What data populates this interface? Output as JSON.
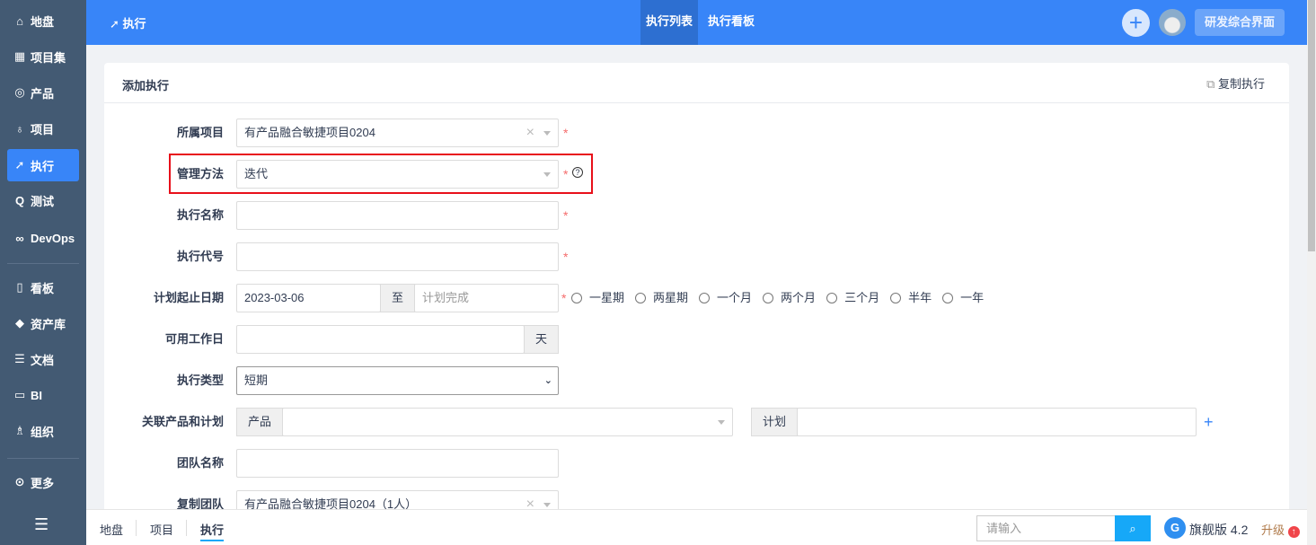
{
  "sidebar": {
    "items": [
      {
        "label": "地盘",
        "icon": "home-icon"
      },
      {
        "label": "项目集",
        "icon": "grid-icon"
      },
      {
        "label": "产品",
        "icon": "bulb-icon"
      },
      {
        "label": "项目",
        "icon": "rocket-icon"
      },
      {
        "label": "执行",
        "icon": "run-icon"
      },
      {
        "label": "测试",
        "icon": "test-icon"
      },
      {
        "label": "DevOps",
        "icon": "infinity-icon"
      },
      {
        "label": "看板",
        "icon": "kanban-icon"
      },
      {
        "label": "资产库",
        "icon": "diamond-icon"
      },
      {
        "label": "文档",
        "icon": "doc-icon"
      },
      {
        "label": "BI",
        "icon": "bi-icon"
      },
      {
        "label": "组织",
        "icon": "users-icon"
      },
      {
        "label": "更多",
        "icon": "more-icon"
      }
    ]
  },
  "header": {
    "title": "执行",
    "tabs": [
      "执行列表",
      "执行看板"
    ],
    "switch_label": "研发综合界面"
  },
  "card": {
    "title": "添加执行",
    "copy_label": "复制执行"
  },
  "form": {
    "project": {
      "label": "所属项目",
      "value": "有产品融合敏捷项目0204"
    },
    "method": {
      "label": "管理方法",
      "value": "迭代"
    },
    "name": {
      "label": "执行名称",
      "value": ""
    },
    "code": {
      "label": "执行代号",
      "value": ""
    },
    "dates": {
      "label": "计划起止日期",
      "begin": "2023-03-06",
      "to": "至",
      "end_placeholder": "计划完成",
      "options": [
        "一星期",
        "两星期",
        "一个月",
        "两个月",
        "三个月",
        "半年",
        "一年"
      ]
    },
    "days": {
      "label": "可用工作日",
      "unit": "天",
      "value": ""
    },
    "type": {
      "label": "执行类型",
      "value": "短期"
    },
    "link": {
      "label": "关联产品和计划",
      "product_addon": "产品",
      "plan_addon": "计划"
    },
    "team": {
      "label": "团队名称",
      "value": ""
    },
    "copy_team": {
      "label": "复制团队",
      "value": "有产品融合敏捷项目0204（1人）"
    }
  },
  "bottom": {
    "crumbs": [
      "地盘",
      "项目",
      "执行"
    ],
    "search_placeholder": "请输入",
    "version": "旗舰版 4.2",
    "upgrade": "升级"
  }
}
